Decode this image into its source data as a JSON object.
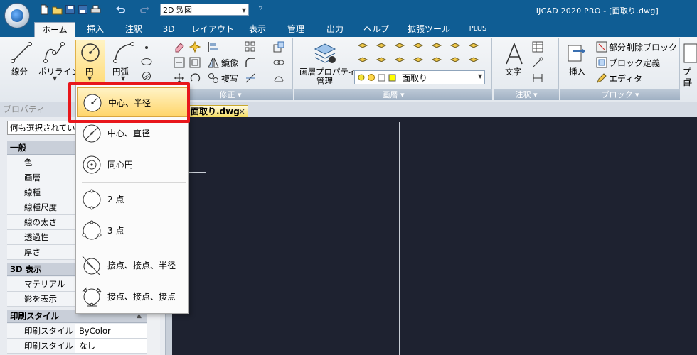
{
  "titlebar": {
    "workspace": "2D 製図",
    "title": "IJCAD 2020 PRO - [面取り.dwg]",
    "bg_color": "#0f5d94"
  },
  "menu_tabs": [
    "ホーム",
    "挿入",
    "注釈",
    "3D",
    "レイアウト",
    "表示",
    "管理",
    "出力",
    "ヘルプ",
    "拡張ツール",
    "PLUS"
  ],
  "ribbon": {
    "draw": {
      "line": "線分",
      "polyline": "ポリライン",
      "circle": "円",
      "arc": "円弧"
    },
    "modify": {
      "title": "修正",
      "mirror": "鏡像",
      "copy": "複写"
    },
    "layer": {
      "title": "画層",
      "props_line1": "画層プロパティ",
      "props_line2": "管理",
      "current_layer": "面取り"
    },
    "annotation": {
      "title": "注釈",
      "text": "文字"
    },
    "block": {
      "title": "ブロック",
      "insert": "挿入",
      "partial_delete": "部分削除ブロック",
      "define": "ブロック定義",
      "editor": "エディタ"
    },
    "cut_label_1": "プロ",
    "cut_label_2": "ユ"
  },
  "properties": {
    "title": "プロパティ",
    "selection": "何も選択されていま",
    "categories": [
      {
        "name": "一般",
        "rows": [
          {
            "key": "色",
            "value": ""
          },
          {
            "key": "画層",
            "value": ""
          },
          {
            "key": "線種",
            "value": ""
          },
          {
            "key": "線種尺度",
            "value": ""
          },
          {
            "key": "線の太さ",
            "value": ""
          },
          {
            "key": "透過性",
            "value": ""
          },
          {
            "key": "厚さ",
            "value": ""
          }
        ]
      },
      {
        "name": "3D 表示",
        "rows": [
          {
            "key": "マテリアル",
            "value": ""
          },
          {
            "key": "影を表示",
            "value": ""
          }
        ]
      },
      {
        "name": "印刷スタイル",
        "rows": [
          {
            "key": "印刷スタイル",
            "value": "ByColor"
          },
          {
            "key": "印刷スタイル ...",
            "value": "なし"
          }
        ]
      }
    ]
  },
  "document": {
    "tab_label": "面取り.dwg",
    "close_glyph": "×"
  },
  "circle_menu": {
    "items": [
      "中心、半径",
      "中心、直径",
      "同心円",
      "2 点",
      "3 点",
      "接点、接点、半径",
      "接点、接点、接点"
    ],
    "highlight_color": "#e8161b"
  }
}
